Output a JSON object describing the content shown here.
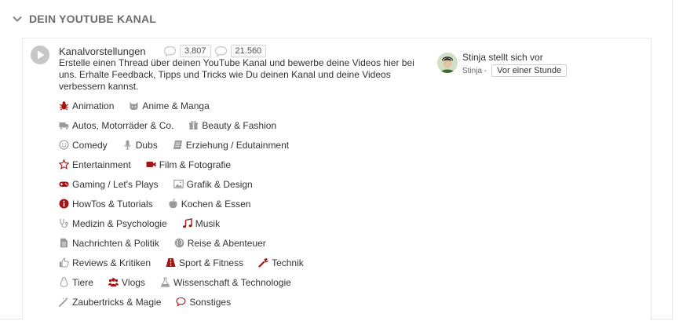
{
  "section": {
    "title": "DEIN YOUTUBE KANAL"
  },
  "forum": {
    "title": "Kanalvorstellungen",
    "threads": "3.807",
    "posts": "21.560",
    "description": "Erstelle einen Thread über deinen YouTube Kanal und bewerbe deine Videos hier bei uns. Erhalte Feedback, Tipps und Tricks wie Du deinen Kanal und deine Videos verbessern kannst."
  },
  "latest": {
    "title": "Stinja stellt sich vor",
    "author": "Stinja -",
    "time": "Vor einer Stunde"
  },
  "subforums": [
    [
      {
        "label": "Animation",
        "icon": "bug-icon",
        "color": "#a31515"
      },
      {
        "label": "Anime & Manga",
        "icon": "cat-icon",
        "color": "#9a9a9a"
      }
    ],
    [
      {
        "label": "Autos, Motorräder & Co.",
        "icon": "truck-icon",
        "color": "#9a9a9a"
      },
      {
        "label": "Beauty & Fashion",
        "icon": "gift-icon",
        "color": "#9a9a9a"
      }
    ],
    [
      {
        "label": "Comedy",
        "icon": "smiley-icon",
        "color": "#9a9a9a"
      },
      {
        "label": "Dubs",
        "icon": "microphone-icon",
        "color": "#9a9a9a"
      },
      {
        "label": "Erziehung / Edutainment",
        "icon": "book-icon",
        "color": "#9a9a9a"
      }
    ],
    [
      {
        "label": "Entertainment",
        "icon": "star-icon",
        "color": "#a31515"
      },
      {
        "label": "Film & Fotografie",
        "icon": "video-camera-icon",
        "color": "#a31515"
      }
    ],
    [
      {
        "label": "Gaming / Let's Plays",
        "icon": "gamepad-icon",
        "color": "#a31515"
      },
      {
        "label": "Grafik & Design",
        "icon": "image-icon",
        "color": "#9a9a9a"
      }
    ],
    [
      {
        "label": "HowTos & Tutorials",
        "icon": "info-icon",
        "color": "#a31515"
      },
      {
        "label": "Kochen & Essen",
        "icon": "apple-icon",
        "color": "#9a9a9a"
      }
    ],
    [
      {
        "label": "Medizin & Psychologie",
        "icon": "stethoscope-icon",
        "color": "#9a9a9a"
      },
      {
        "label": "Musik",
        "icon": "music-icon",
        "color": "#a31515"
      }
    ],
    [
      {
        "label": "Nachrichten & Politik",
        "icon": "document-icon",
        "color": "#9a9a9a"
      },
      {
        "label": "Reise & Abenteuer",
        "icon": "globe-icon",
        "color": "#9a9a9a"
      }
    ],
    [
      {
        "label": "Reviews & Kritiken",
        "icon": "thumbs-up-icon",
        "color": "#9a9a9a"
      },
      {
        "label": "Sport & Fitness",
        "icon": "road-icon",
        "color": "#a31515"
      },
      {
        "label": "Technik",
        "icon": "wrench-icon",
        "color": "#a31515"
      }
    ],
    [
      {
        "label": "Tiere",
        "icon": "penguin-icon",
        "color": "#9a9a9a"
      },
      {
        "label": "Vlogs",
        "icon": "users-icon",
        "color": "#a31515"
      },
      {
        "label": "Wissenschaft & Technologie",
        "icon": "flask-icon",
        "color": "#9a9a9a"
      }
    ],
    [
      {
        "label": "Zaubertricks & Magie",
        "icon": "magic-wand-icon",
        "color": "#9a9a9a"
      },
      {
        "label": "Sonstiges",
        "icon": "comment-icon",
        "color": "#a31515"
      }
    ]
  ]
}
